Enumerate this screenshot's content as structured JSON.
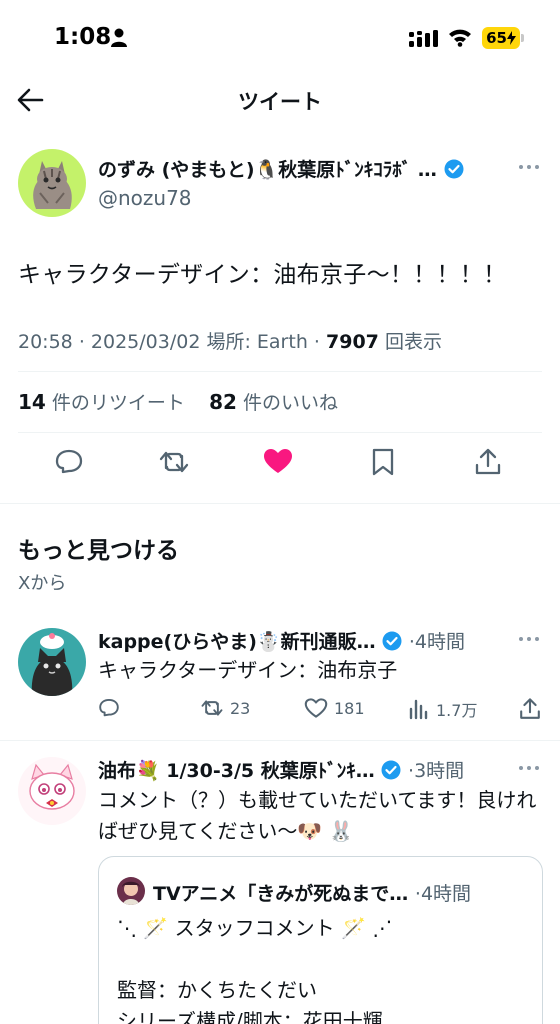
{
  "status_bar": {
    "time": "1:08",
    "battery": "65"
  },
  "nav": {
    "title": "ツイート"
  },
  "tweet": {
    "author_name": "のずみ (やまもと)🐧秋葉原ﾄﾞﾝｷｺﾗﾎﾞ …",
    "handle": "@nozu78",
    "text": "キャラクターデザイン：油布京子〜！！！！！",
    "time": "20:58",
    "date": "2025/03/02",
    "location_label": "場所: Earth",
    "views": "7907",
    "views_label": "回表示",
    "retweets": "14",
    "retweets_label": "件のリツイート",
    "likes": "82",
    "likes_label": "件のいいね"
  },
  "discover": {
    "title": "もっと見つける",
    "subtitle": "Xから"
  },
  "feed": [
    {
      "name": "kappe(ひらやま)☃️新刊通販…",
      "time": "4時間",
      "text": "キャラクターデザイン：油布京子",
      "retweets": "23",
      "likes": "181",
      "views": "1.7万"
    },
    {
      "name": "油布💐 1/30-3/5 秋葉原ﾄﾞﾝｷ…",
      "time": "3時間",
      "text": "コメント（？）も載せていただいてます！良ければぜひ見てください〜🐶 🐰",
      "quote": {
        "name": "TVアニメ「きみが死ぬまで…",
        "time": "4時間",
        "text": "⋱ 🪄 スタッフコメント 🪄 ⋰\n\n監督：かくちたくだい\nシリーズ構成/脚本：花田十輝"
      }
    }
  ],
  "colors": {
    "accent": "#1d9bf0",
    "like": "#f91880",
    "muted": "#536471",
    "battery": "#ffd60a"
  }
}
